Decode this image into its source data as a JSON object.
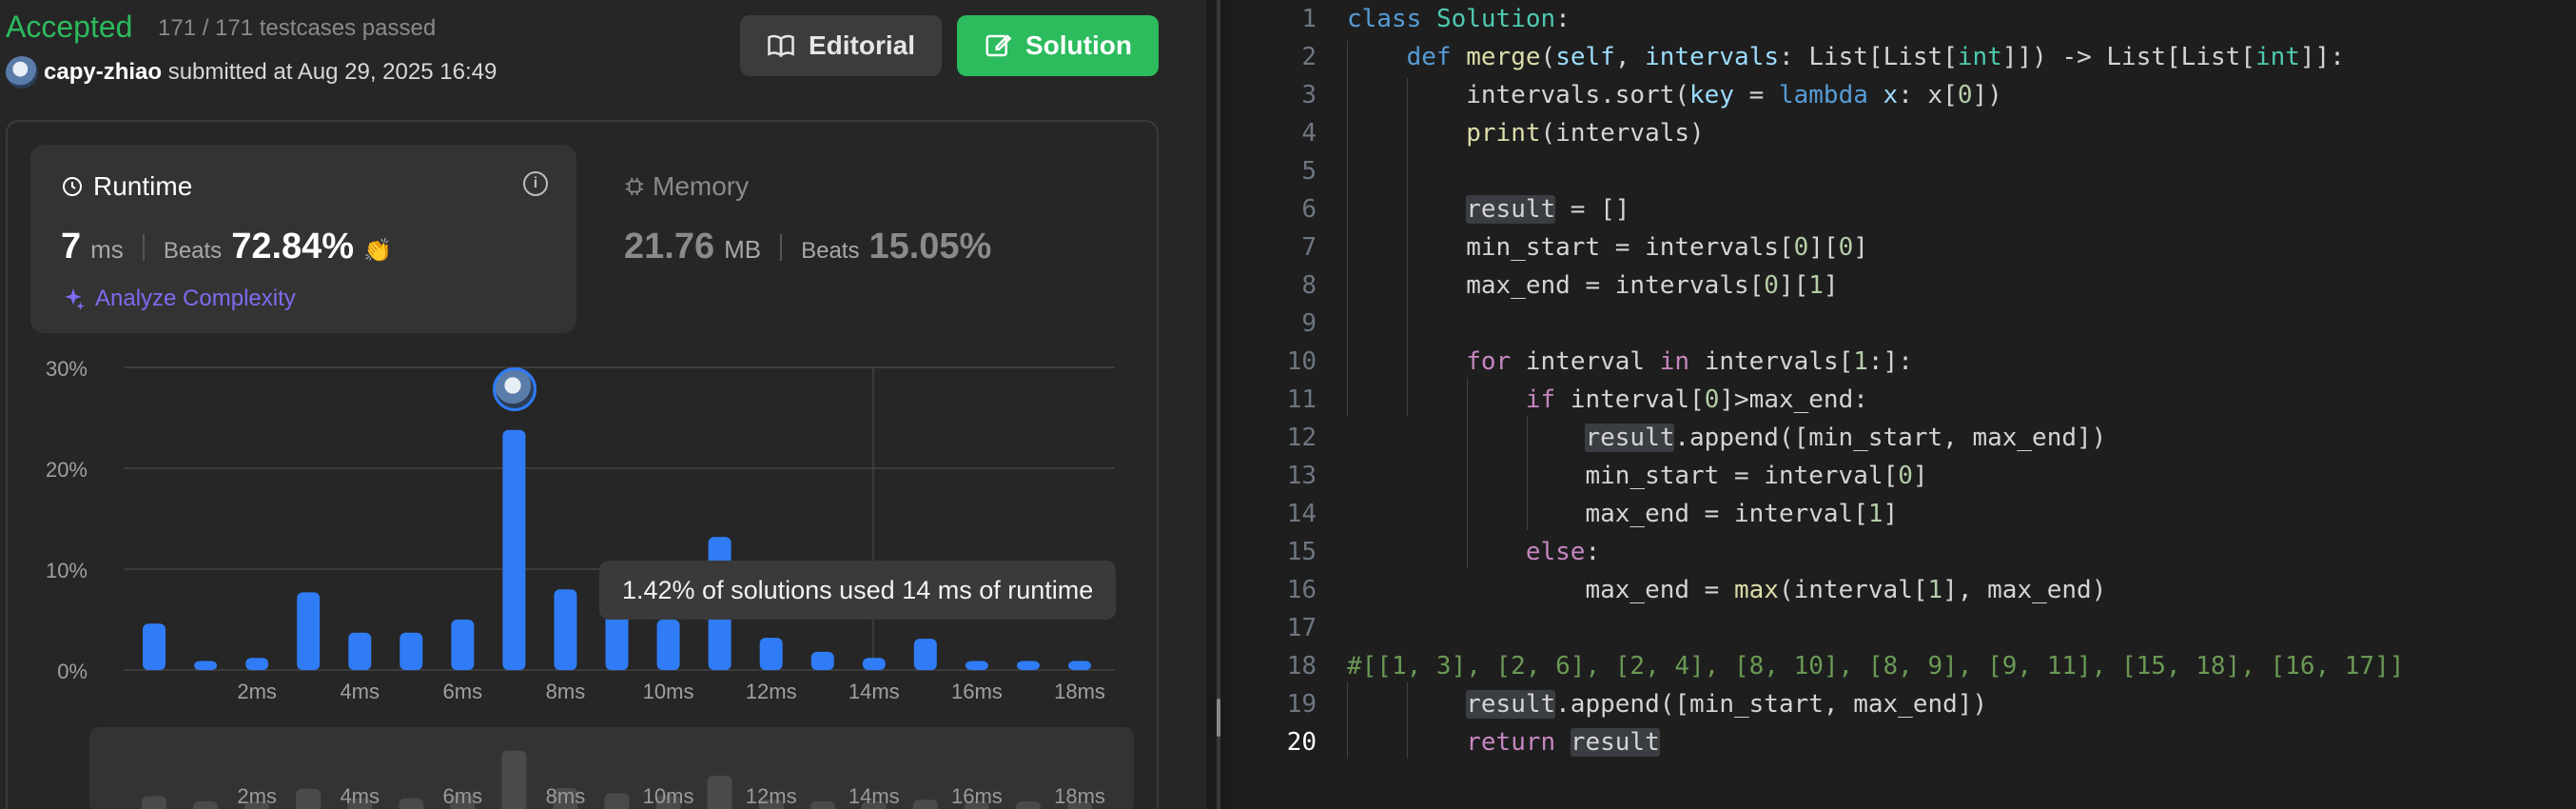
{
  "result": {
    "status": "Accepted",
    "testcases": "171 / 171 testcases passed",
    "user": "capy-zhiao",
    "submitted": "submitted at Aug 29, 2025 16:49"
  },
  "buttons": {
    "editorial": "Editorial",
    "solution": "Solution"
  },
  "runtime": {
    "title": "Runtime",
    "value": "7",
    "unit": "ms",
    "beats_label": "Beats",
    "beats": "72.84%",
    "analyze": "Analyze Complexity"
  },
  "memory": {
    "title": "Memory",
    "value": "21.76",
    "unit": "MB",
    "beats_label": "Beats",
    "beats": "15.05%"
  },
  "tooltip": "1.42% of solutions used 14 ms of runtime",
  "colors": {
    "accepted": "#2cbb5d",
    "bar": "#2f7cf6",
    "analyze": "#7c6cf0"
  },
  "chart_data": {
    "type": "bar",
    "x": [
      0,
      1,
      2,
      3,
      4,
      5,
      6,
      7,
      8,
      9,
      10,
      11,
      12,
      13,
      14,
      15,
      16,
      17,
      18,
      19
    ],
    "values": [
      4.6,
      0.9,
      1.2,
      7.7,
      3.7,
      3.7,
      5.0,
      23.8,
      8.0,
      5.8,
      5.0,
      13.2,
      3.2,
      1.8,
      1.2,
      3.1,
      0.9,
      0.9,
      0.9,
      0
    ],
    "yticks": [
      "0%",
      "10%",
      "20%",
      "30%"
    ],
    "xticks": [
      "2ms",
      "4ms",
      "6ms",
      "8ms",
      "10ms",
      "12ms",
      "14ms",
      "16ms",
      "18ms"
    ],
    "ylim": [
      0,
      30
    ],
    "highlight": "7ms"
  },
  "editor": {
    "line_numbers": [
      "1",
      "2",
      "3",
      "4",
      "5",
      "6",
      "7",
      "8",
      "9",
      "10",
      "11",
      "12",
      "13",
      "14",
      "15",
      "16",
      "17",
      "18",
      "19",
      "20"
    ]
  }
}
